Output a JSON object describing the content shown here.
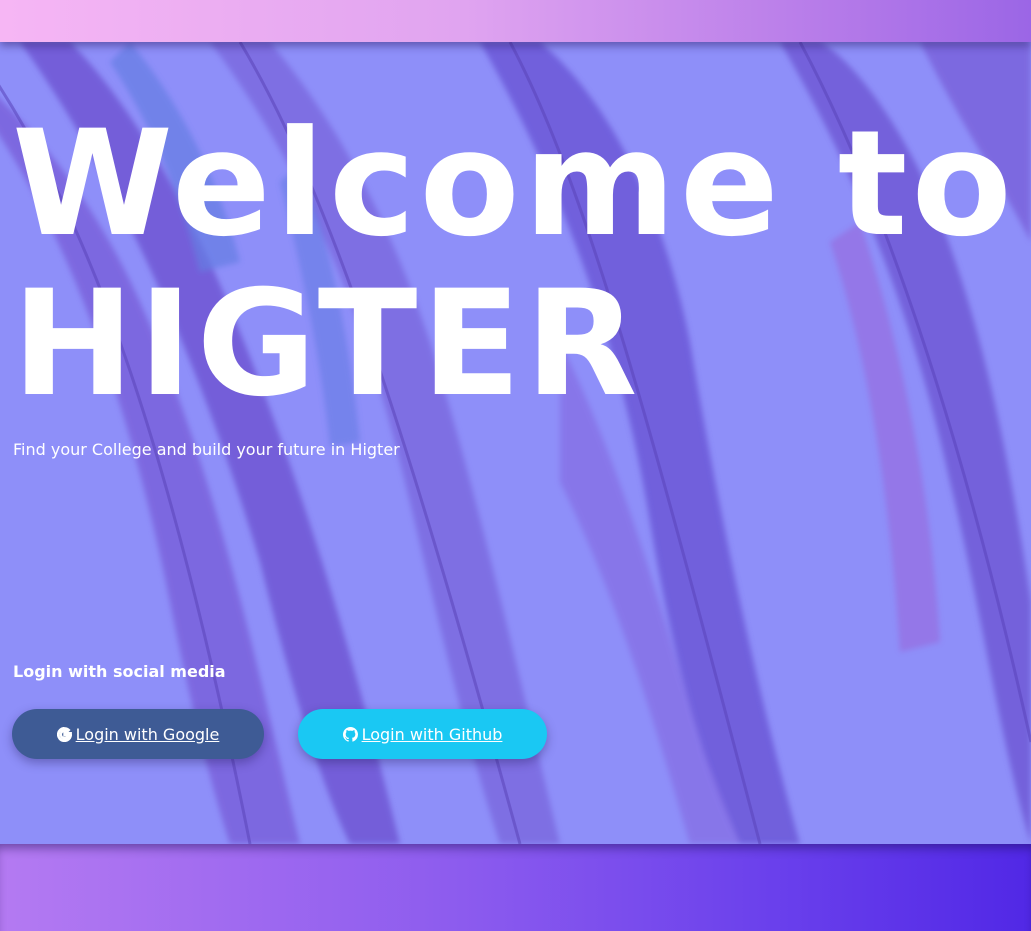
{
  "hero": {
    "title_line1": "Welcome to",
    "title_line2": "HIGTER",
    "tagline": "Find your College and build your future in Higter"
  },
  "login": {
    "heading": "Login with social media",
    "google_label": "Login with Google",
    "github_label": "Login with Github"
  },
  "icons": {
    "google": "google-icon",
    "github": "github-icon"
  },
  "colors": {
    "hero_overlay": "#8e8ff9",
    "google_button": "#3e5b95",
    "github_button": "#1ac8f3",
    "text": "#ffffff"
  }
}
